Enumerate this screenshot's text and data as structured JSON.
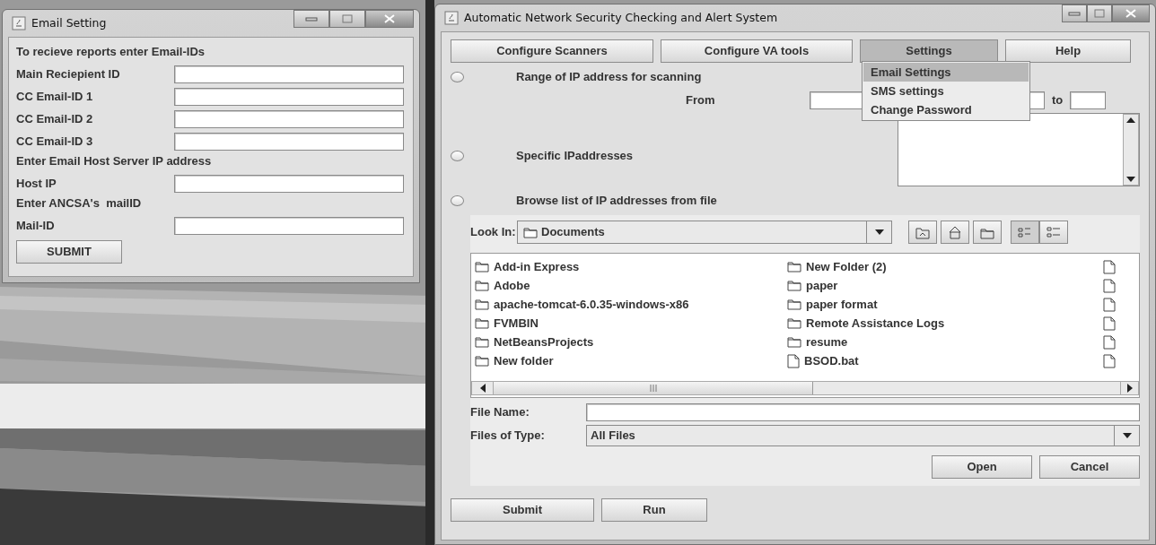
{
  "email_window": {
    "title": "Email Setting",
    "items": [
      {
        "kind": "heading",
        "text": "To recieve reports enter Email-IDs"
      },
      {
        "kind": "field",
        "label": "Main Reciepient ID"
      },
      {
        "kind": "field",
        "label": "CC Email-ID 1"
      },
      {
        "kind": "field",
        "label": "CC Email-ID 2"
      },
      {
        "kind": "field",
        "label": "CC Email-ID 3"
      },
      {
        "kind": "heading",
        "text": "Enter Email Host Server IP address"
      },
      {
        "kind": "field",
        "label": "Host IP"
      },
      {
        "kind": "heading",
        "text": "Enter ANCSA's  mailID"
      },
      {
        "kind": "field",
        "label": "Mail-ID"
      }
    ],
    "submit": "SUBMIT"
  },
  "main_window": {
    "title": "Automatic Network Security Checking and Alert System",
    "menu_buttons": [
      {
        "label": "Configure Scanners",
        "selected": false
      },
      {
        "label": "Configure VA tools",
        "selected": false
      },
      {
        "label": "Settings",
        "selected": true
      },
      {
        "label": "Help",
        "selected": false
      }
    ],
    "settings_menu": [
      {
        "label": "Email Settings",
        "selected": true
      },
      {
        "label": "SMS settings",
        "selected": false
      },
      {
        "label": "Change Password",
        "selected": false
      }
    ],
    "options": [
      {
        "label": "Range of IP address for scanning",
        "selected": false
      },
      {
        "label": "Specific IPaddresses",
        "selected": false
      },
      {
        "label": "Browse list of IP addresses from file",
        "selected": false
      }
    ],
    "range": {
      "from_label": "From",
      "to_label": "to"
    },
    "file_chooser": {
      "look_in_label": "Look In:",
      "look_in_value": "Documents",
      "file_columns": [
        [
          {
            "kind": "folder",
            "name": "Add-in Express"
          },
          {
            "kind": "folder",
            "name": "Adobe"
          },
          {
            "kind": "folder",
            "name": "apache-tomcat-6.0.35-windows-x86"
          },
          {
            "kind": "folder",
            "name": "FVMBIN"
          },
          {
            "kind": "folder",
            "name": "NetBeansProjects"
          },
          {
            "kind": "folder",
            "name": "New folder"
          }
        ],
        [
          {
            "kind": "folder",
            "name": "New Folder (2)"
          },
          {
            "kind": "folder",
            "name": "paper"
          },
          {
            "kind": "folder",
            "name": "paper format"
          },
          {
            "kind": "folder",
            "name": "Remote Assistance Logs"
          },
          {
            "kind": "folder",
            "name": "resume"
          },
          {
            "kind": "file",
            "name": "BSOD.bat"
          }
        ],
        [
          {
            "kind": "file"
          },
          {
            "kind": "file"
          },
          {
            "kind": "file"
          },
          {
            "kind": "file"
          },
          {
            "kind": "file"
          },
          {
            "kind": "file"
          }
        ]
      ],
      "file_name_label": "File Name:",
      "files_of_type_label": "Files of Type:",
      "files_of_type_value": "All Files",
      "buttons": [
        "Open",
        "Cancel"
      ]
    },
    "buttons": [
      "Submit",
      "Run"
    ]
  }
}
